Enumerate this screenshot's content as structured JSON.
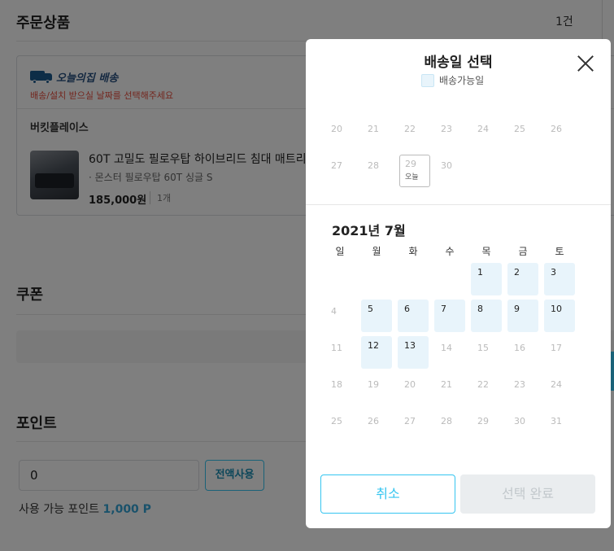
{
  "order": {
    "title": "주문상품",
    "count": "1건",
    "delivery_brand": "오늘의집 배송",
    "notice": "배송/설치 받으실 날짜를 선택해주세요",
    "seller": "버킷플레이스",
    "product_name": "60T 고밀도 필로우탑 하이브리드 침대 매트리스",
    "option": "· 몬스터 필로우탑 60T 싱글 S",
    "price": "185,000원",
    "quantity": "1개"
  },
  "coupon": {
    "title": "쿠폰"
  },
  "points": {
    "title": "포인트",
    "input_value": "0",
    "use_all_label": "전액사용",
    "available_label": "사용 가능 포인트",
    "available_value": "1,000 P"
  },
  "modal": {
    "title": "배송일 선택",
    "legend_label": "배송가능일",
    "prev_month_rows": [
      [
        "20",
        "21",
        "22",
        "23",
        "24",
        "25",
        "26"
      ],
      [
        "27",
        "28",
        "29",
        "30",
        "",
        "",
        ""
      ]
    ],
    "today_day": "29",
    "today_label": "오늘",
    "month_label": "2021년 7월",
    "weekdays": [
      "일",
      "월",
      "화",
      "수",
      "목",
      "금",
      "토"
    ],
    "month_rows": [
      [
        "",
        "",
        "",
        "",
        "1",
        "2",
        "3"
      ],
      [
        "4",
        "5",
        "6",
        "7",
        "8",
        "9",
        "10"
      ],
      [
        "11",
        "12",
        "13",
        "14",
        "15",
        "16",
        "17"
      ],
      [
        "18",
        "19",
        "20",
        "21",
        "22",
        "23",
        "24"
      ],
      [
        "25",
        "26",
        "27",
        "28",
        "29",
        "30",
        "31"
      ]
    ],
    "available_days": [
      "1",
      "2",
      "3",
      "5",
      "6",
      "7",
      "8",
      "9",
      "10",
      "12",
      "13"
    ],
    "cancel_label": "취소",
    "done_label": "선택 완료"
  },
  "colors": {
    "accent": "#35c5f0",
    "available_bg": "#e8f4fb",
    "warning": "#e74c3c"
  }
}
